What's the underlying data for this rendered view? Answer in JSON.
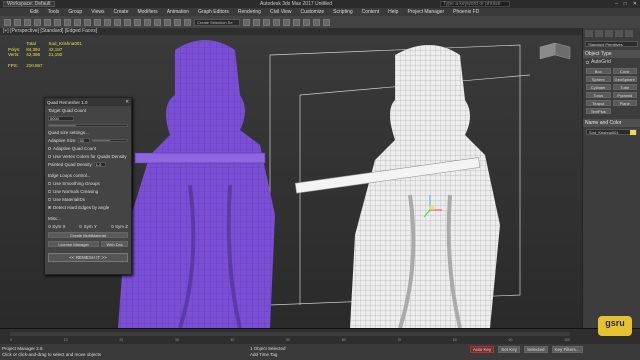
{
  "titlebar": {
    "workspace": "Workspace: Default",
    "app_title": "Autodesk 3ds Max 2017    Untitled",
    "search_placeholder": "Type a keyword or phrase"
  },
  "menubar": {
    "items": [
      "Edit",
      "Tools",
      "Group",
      "Views",
      "Create",
      "Modifiers",
      "Animation",
      "Graph Editors",
      "Rendering",
      "Civil View",
      "Customize",
      "Scripting",
      "Content",
      "Help",
      "Project Manager",
      "Phoenix FD"
    ]
  },
  "toolbar": {
    "selection_set": "Create Selection Se"
  },
  "viewport": {
    "label": "[+] [Perspective] [Standard] [Edged Faces]",
    "stats": {
      "total_label": "Total",
      "object_name": "Sod_Krishna001",
      "polys_label": "Polys:",
      "polys_total": "84,394",
      "polys_obj": "42,197",
      "verts_label": "Verts:",
      "verts_total": "42,396",
      "verts_obj": "21,192",
      "fps_label": "FPS:",
      "fps_value": "210.557"
    }
  },
  "dialog": {
    "title": "Quad Remesher 1.0",
    "target_label": "Target Quad Count",
    "target_value": "5000",
    "target_fill": 0.35,
    "quad_size_label": "Quad size settings...",
    "adaptive_size_label": "Adaptive Size",
    "adaptive_size_value": "50",
    "adaptive_fill": 0.5,
    "adaptive_quad_count": "Adaptive Quad Count",
    "use_vertex_colors": "Use Vertex Colors for Quads Density",
    "painted_density_label": "Painted Quad Density",
    "painted_density_value": "1.0",
    "edge_loops_label": "Edge Loops control...",
    "use_smoothing": "Use Smoothing Groups",
    "use_normals": "Use Normals Creasing",
    "use_material": "Use MaterialIDs",
    "detect_hard": "Detect Hard Edges by angle",
    "misc_label": "Misc...",
    "sym_x": "Sym X",
    "sym_y": "Sym Y",
    "sym_z": "Sym Z",
    "create_multimaterial": "Create MultiMaterial",
    "license_manager": "License Manager",
    "web_doc": "Web Doc",
    "remesh_button": "<< REMESH IT >>"
  },
  "command_panel": {
    "dropdown": "Standard Primitives",
    "object_type_label": "Object Type",
    "autogrid": "AutoGrid",
    "objects": [
      "Box",
      "Cone",
      "Sphere",
      "GeoSphere",
      "Cylinder",
      "Tube",
      "Torus",
      "Pyramid",
      "Teapot",
      "Plane",
      "TextPlus",
      ""
    ],
    "name_color_label": "Name and Color",
    "object_name": "Sod_Krishna001"
  },
  "timeline": {
    "ticks": [
      "0",
      "10",
      "20",
      "30",
      "40",
      "50",
      "60",
      "70",
      "80",
      "90",
      "100"
    ]
  },
  "statusbar": {
    "line1": "Project Manager 2.6",
    "line2": "Click or click-and-drag to select and move objects",
    "selection": "1 Object Selected",
    "add_time_tag": "Add Time Tag",
    "autokey": "Auto Key",
    "setkey": "Set Key",
    "selected": "Selected",
    "key_filters": "Key Filters..."
  },
  "logo": {
    "text": "gsru"
  },
  "colors": {
    "stats_yellow": "#e6e24a",
    "mesh_purple": "#7a4fd6",
    "mesh_white": "#ededed"
  }
}
